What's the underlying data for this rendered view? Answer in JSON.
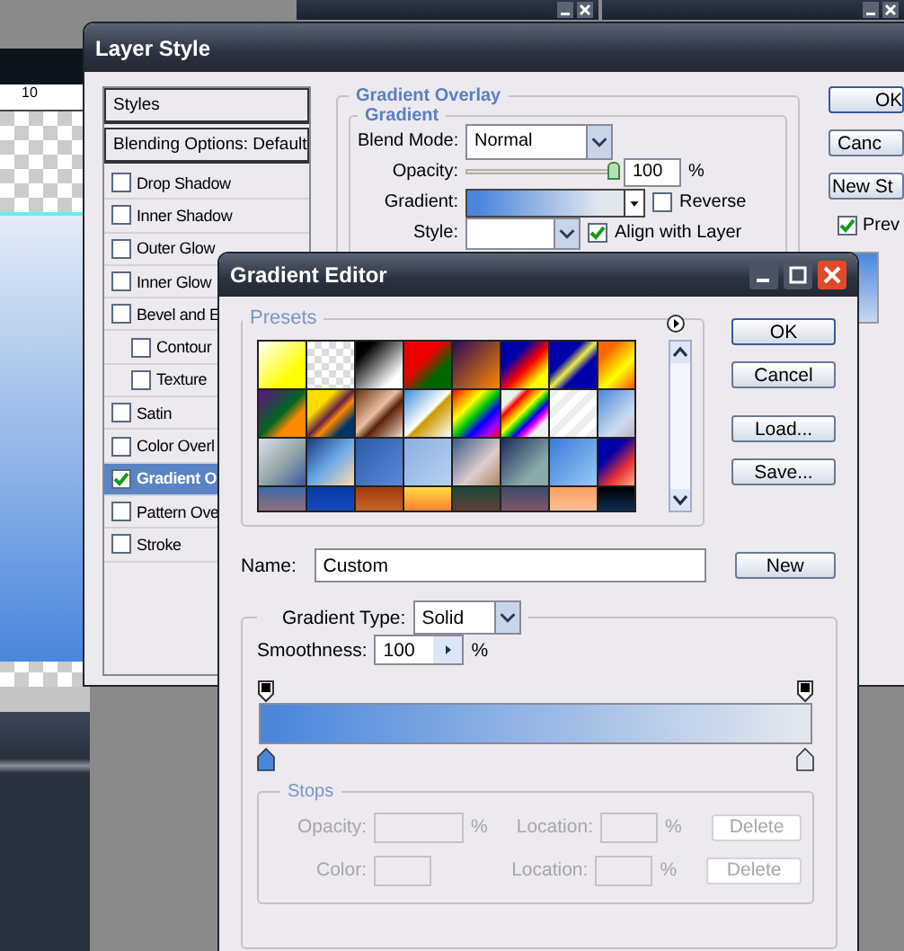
{
  "document": {
    "ruler_label": "10"
  },
  "layer_style": {
    "title": "Layer Style",
    "styles_header": "Styles",
    "blending_options": "Blending Options: Default",
    "effects": [
      {
        "label": "Drop Shadow",
        "checked": false,
        "selected": false
      },
      {
        "label": "Inner Shadow",
        "checked": false,
        "selected": false
      },
      {
        "label": "Outer Glow",
        "checked": false,
        "selected": false
      },
      {
        "label": "Inner Glow",
        "checked": false,
        "selected": false
      },
      {
        "label": "Bevel and E",
        "checked": false,
        "selected": false,
        "children": [
          {
            "label": "Contour",
            "checked": false,
            "selected": false
          },
          {
            "label": "Texture",
            "checked": false,
            "selected": false
          }
        ]
      },
      {
        "label": "Satin",
        "checked": false,
        "selected": false
      },
      {
        "label": "Color Overl",
        "checked": false,
        "selected": false
      },
      {
        "label": "Gradient O",
        "checked": true,
        "selected": true
      },
      {
        "label": "Pattern Ove",
        "checked": false,
        "selected": false
      },
      {
        "label": "Stroke",
        "checked": false,
        "selected": false
      }
    ],
    "gradient_overlay": {
      "group_title": "Gradient Overlay",
      "subgroup_title": "Gradient",
      "blend_mode": {
        "label": "Blend Mode:",
        "value": "Normal"
      },
      "opacity": {
        "label": "Opacity:",
        "value": "100",
        "unit": "%",
        "level": 1
      },
      "gradient": {
        "label": "Gradient:",
        "stops": [
          {
            "color": "#4a86dc"
          },
          {
            "color": "#e2e7ee"
          }
        ]
      },
      "reverse": {
        "label": "Reverse",
        "checked": false
      },
      "style": {
        "label": "Style:"
      },
      "align_with_layer": {
        "label": "Align with Layer",
        "checked": true
      }
    },
    "buttons": [
      "OK",
      "Canc",
      "New St"
    ],
    "preview": {
      "label": "Prev",
      "checked": true
    }
  },
  "gradient_editor": {
    "title": "Gradient Editor",
    "presets_title": "Presets",
    "buttons": [
      "OK",
      "Cancel",
      "Load...",
      "Save..."
    ],
    "name": {
      "label": "Name:",
      "value": "Custom"
    },
    "new_button": "New",
    "gradient_type": {
      "label": "Gradient Type:",
      "value": "Solid"
    },
    "smoothness": {
      "label": "Smoothness:",
      "value": "100",
      "unit": "%"
    },
    "opacity_stops": [
      {
        "color": "#000000"
      },
      {
        "color": "#000000"
      }
    ],
    "color_stops": [
      {
        "color": "#4a86dc"
      },
      {
        "color": "#e2e7ee"
      }
    ],
    "stops_group": {
      "title": "Stops",
      "disabled": true,
      "rows": [
        {
          "label": "Opacity:",
          "unit": "%",
          "location_label": "Location:",
          "location_unit": "%",
          "delete": "Delete"
        },
        {
          "label": "Color:",
          "location_label": "Location:",
          "location_unit": "%",
          "delete": "Delete"
        }
      ]
    }
  }
}
